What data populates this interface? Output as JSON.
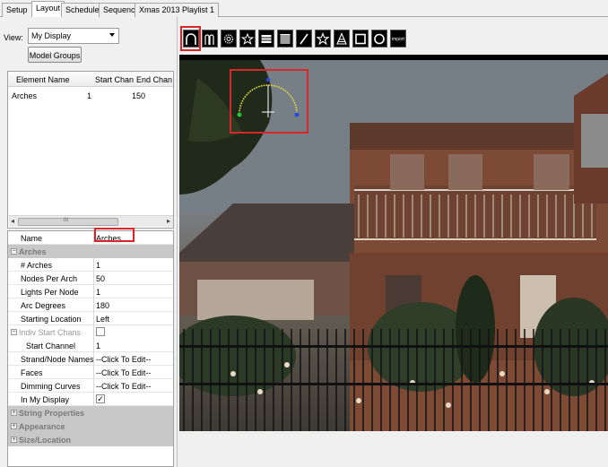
{
  "tabs": [
    {
      "label": "Setup"
    },
    {
      "label": "Layout"
    },
    {
      "label": "Schedule"
    },
    {
      "label": "Sequencer"
    },
    {
      "label": "Xmas 2013 Playlist 1"
    }
  ],
  "view": {
    "label": "View:",
    "selected": "My Display"
  },
  "model_groups_button": "Model Groups",
  "element_list": {
    "columns": [
      "Element Name",
      "Start Chan",
      "End Chan"
    ],
    "rows": [
      {
        "name": "Arches",
        "start": "1",
        "end": "150"
      }
    ],
    "scroll_left": "◂",
    "scroll_grip": "III",
    "scroll_right": "▸"
  },
  "properties": {
    "name_label": "Name",
    "name_value": "Arches",
    "arches_category": "Arches",
    "rows": [
      {
        "label": "# Arches",
        "value": "1"
      },
      {
        "label": "Nodes Per Arch",
        "value": "50"
      },
      {
        "label": "Lights Per Node",
        "value": "1"
      },
      {
        "label": "Arc Degrees",
        "value": "180"
      },
      {
        "label": "Starting Location",
        "value": "Left"
      }
    ],
    "indiv_start_chans": "Indiv Start Chans",
    "start_channel_label": "Start Channel",
    "start_channel_value": "1",
    "strand_node_names": {
      "label": "Strand/Node Names",
      "value": "--Click To Edit--"
    },
    "faces": {
      "label": "Faces",
      "value": "--Click To Edit--"
    },
    "dimming_curves": {
      "label": "Dimming Curves",
      "value": "--Click To Edit--"
    },
    "in_my_display": {
      "label": "In My Display",
      "checked": "✓"
    },
    "string_properties": "String Properties",
    "appearance": "Appearance",
    "size_location": "Size/Location",
    "expand_minus": "−",
    "expand_plus": "+"
  },
  "toolbar": {
    "import_label": "import",
    "icons": [
      "arches-icon",
      "candy-canes-icon",
      "circle-icon",
      "star-icon",
      "matrix-icon",
      "grid-icon",
      "line-icon",
      "star-outline-icon",
      "tree-icon",
      "window-frame-icon",
      "wreath-icon",
      "import-icon"
    ]
  },
  "colors": {
    "highlight": "#d9262b",
    "arch_line": "#e8e040",
    "arch_start": "#2fc02f",
    "arch_end": "#2a46e0"
  }
}
